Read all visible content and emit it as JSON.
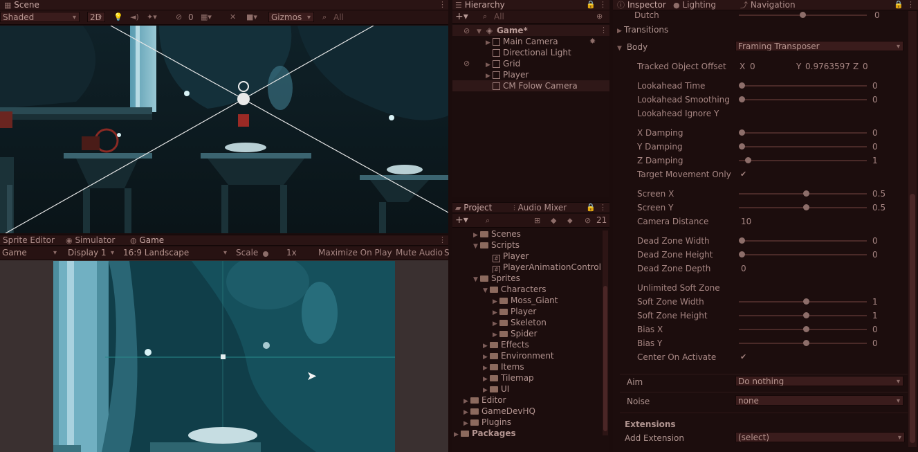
{
  "scene": {
    "tab_label": "Scene",
    "shading_mode": "Shaded",
    "mode_2d": "2D",
    "hidden_count": "0",
    "gizmos": "Gizmos",
    "search_placeholder": "All"
  },
  "bottom_tabs": {
    "sprite_editor": "Sprite Editor",
    "simulator": "Simulator",
    "game": "Game"
  },
  "game": {
    "mode": "Game",
    "display": "Display 1",
    "aspect": "16:9 Landscape",
    "scale_label": "Scale",
    "scale_value": "1x",
    "maximize": "Maximize On Play",
    "mute": "Mute Audio",
    "extra": "S"
  },
  "hierarchy": {
    "tab_label": "Hierarchy",
    "search_placeholder": "All",
    "scene_name": "Game*",
    "items": [
      {
        "label": "Main Camera"
      },
      {
        "label": "Directional Light"
      },
      {
        "label": "Grid"
      },
      {
        "label": "Player"
      },
      {
        "label": "CM Folow Camera"
      }
    ]
  },
  "project": {
    "tab_label": "Project",
    "audio_tab_label": "Audio Mixer",
    "hidden_count": "21",
    "items": [
      {
        "label": "Scenes",
        "type": "folder"
      },
      {
        "label": "Scripts",
        "type": "folder"
      },
      {
        "label": "Player",
        "type": "script"
      },
      {
        "label": "PlayerAnimationControlle",
        "type": "script"
      },
      {
        "label": "Sprites",
        "type": "folder"
      },
      {
        "label": "Characters",
        "type": "folder"
      },
      {
        "label": "Moss_Giant",
        "type": "folder"
      },
      {
        "label": "Player",
        "type": "folder"
      },
      {
        "label": "Skeleton",
        "type": "folder"
      },
      {
        "label": "Spider",
        "type": "folder"
      },
      {
        "label": "Effects",
        "type": "folder"
      },
      {
        "label": "Environment",
        "type": "folder"
      },
      {
        "label": "Items",
        "type": "folder"
      },
      {
        "label": "Tilemap",
        "type": "folder"
      },
      {
        "label": "UI",
        "type": "folder"
      },
      {
        "label": "Editor",
        "type": "folder"
      },
      {
        "label": "GameDevHQ",
        "type": "folder"
      },
      {
        "label": "Plugins",
        "type": "folder"
      },
      {
        "label": "Packages",
        "type": "folder"
      }
    ]
  },
  "inspector": {
    "tab_label": "Inspector",
    "lighting_label": "Lighting",
    "navigation_label": "Navigation",
    "dutch_label": "Dutch",
    "dutch_value": "0",
    "transitions_label": "Transitions",
    "body_label": "Body",
    "body_value": "Framing Transposer",
    "tracked_offset_label": "Tracked Object Offset",
    "tracked_offset": {
      "x_label": "X",
      "x": "0",
      "y_label": "Y",
      "y": "0.9763597",
      "z_label": "Z",
      "z": "0"
    },
    "rows": [
      {
        "label": "Lookahead Time",
        "kind": "slider",
        "value": "0",
        "fraction": 0.0
      },
      {
        "label": "Lookahead Smoothing",
        "kind": "slider",
        "value": "0",
        "fraction": 0.0
      },
      {
        "label": "Lookahead Ignore Y",
        "kind": "blank"
      },
      {
        "label": "X Damping",
        "kind": "slider",
        "value": "0",
        "fraction": 0.0
      },
      {
        "label": "Y Damping",
        "kind": "slider",
        "value": "0",
        "fraction": 0.0
      },
      {
        "label": "Z Damping",
        "kind": "slider",
        "value": "1",
        "fraction": 0.05
      },
      {
        "label": "Target Movement Only",
        "kind": "check"
      },
      {
        "label": "Screen X",
        "kind": "slider",
        "value": "0.5",
        "fraction": 0.5
      },
      {
        "label": "Screen Y",
        "kind": "slider",
        "value": "0.5",
        "fraction": 0.5
      },
      {
        "label": "Camera Distance",
        "kind": "number",
        "value": "10"
      },
      {
        "label": "Dead Zone Width",
        "kind": "slider",
        "value": "0",
        "fraction": 0.0
      },
      {
        "label": "Dead Zone Height",
        "kind": "slider",
        "value": "0",
        "fraction": 0.0
      },
      {
        "label": "Dead Zone Depth",
        "kind": "number",
        "value": "0"
      },
      {
        "label": "Unlimited Soft Zone",
        "kind": "blank"
      },
      {
        "label": "Soft Zone Width",
        "kind": "slider",
        "value": "1",
        "fraction": 0.5
      },
      {
        "label": "Soft Zone Height",
        "kind": "slider",
        "value": "1",
        "fraction": 0.5
      },
      {
        "label": "Bias X",
        "kind": "slider",
        "value": "0",
        "fraction": 0.5
      },
      {
        "label": "Bias Y",
        "kind": "slider",
        "value": "0",
        "fraction": 0.5
      },
      {
        "label": "Center On Activate",
        "kind": "check"
      }
    ],
    "aim_label": "Aim",
    "aim_value": "Do nothing",
    "noise_label": "Noise",
    "noise_value": "none",
    "extensions_label": "Extensions",
    "add_extension_label": "Add Extension",
    "add_extension_value": "(select)"
  }
}
